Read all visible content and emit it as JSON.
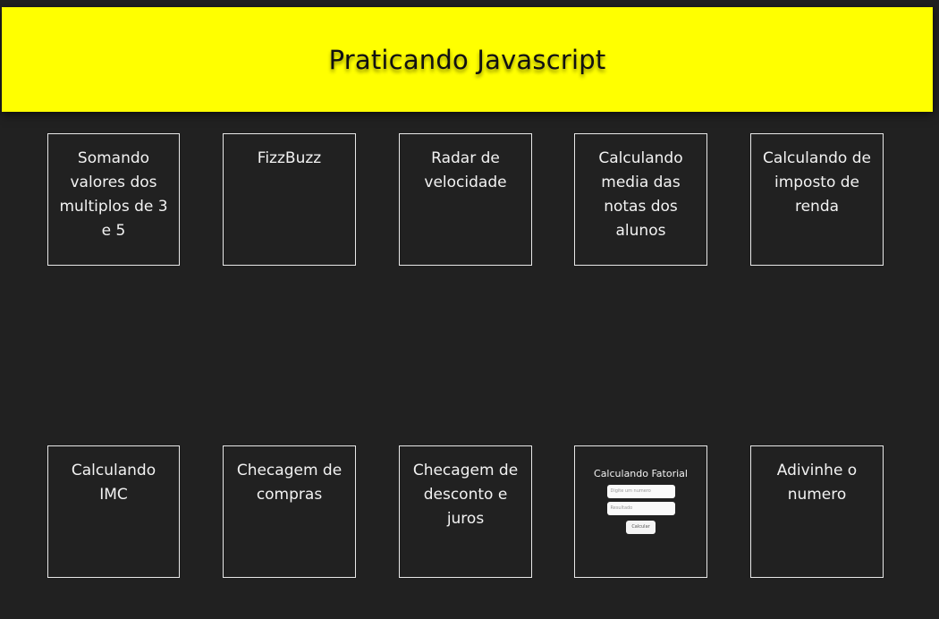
{
  "header": {
    "title": "Praticando Javascript"
  },
  "cards": [
    {
      "label": "Somando valores dos multiplos de 3 e 5"
    },
    {
      "label": "FizzBuzz"
    },
    {
      "label": "Radar de velocidade"
    },
    {
      "label": "Calculando media das notas dos alunos"
    },
    {
      "label": "Calculando de imposto de renda"
    },
    {
      "label": "Calculando IMC"
    },
    {
      "label": "Checagem de compras"
    },
    {
      "label": "Checagem de desconto e juros"
    },
    {
      "preview": {
        "title": "Calculando Fatorial",
        "input_placeholder": "Digite um numero",
        "result_placeholder": "Resultado",
        "button_label": "Calcular"
      }
    },
    {
      "label": "Adivinhe o numero"
    }
  ],
  "colors": {
    "background": "#212121",
    "header_bg": "#ffff00",
    "card_border": "#e8e8e8",
    "card_text": "#f2f2f2"
  }
}
